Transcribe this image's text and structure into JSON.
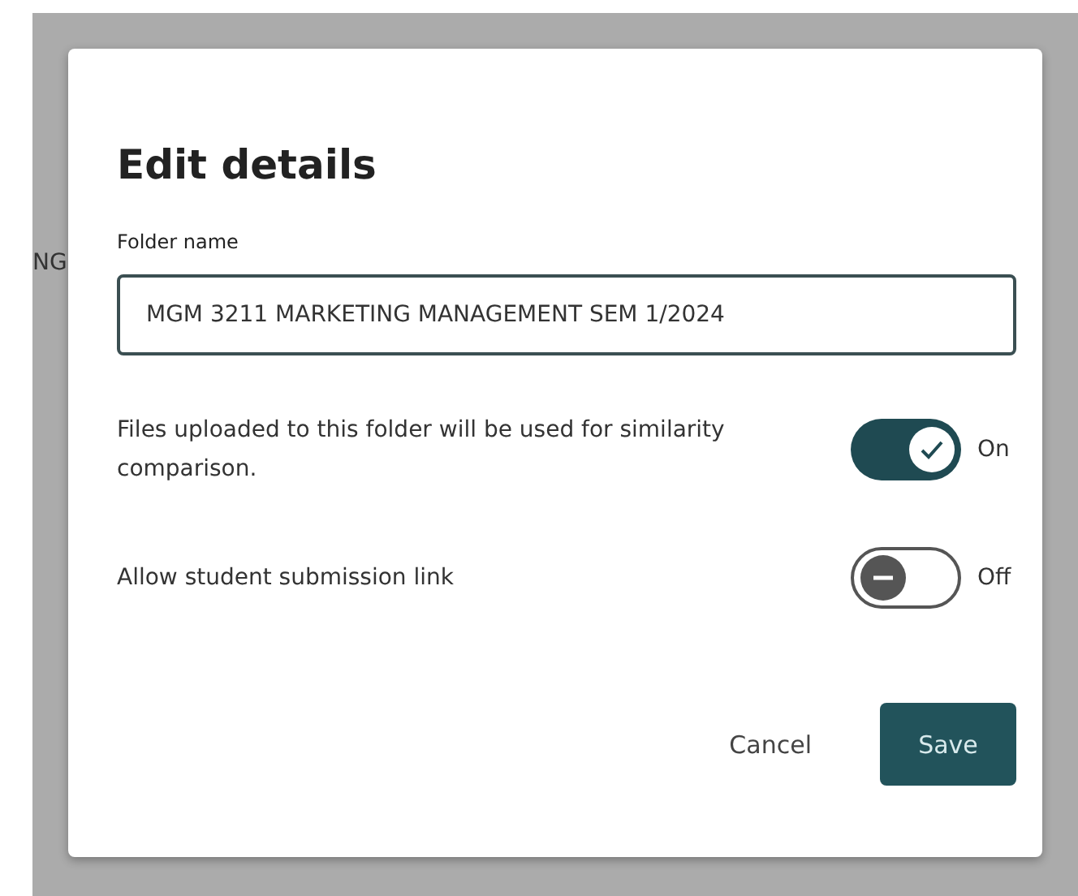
{
  "background": {
    "partial_text": "NG"
  },
  "dialog": {
    "title": "Edit details",
    "folder_name": {
      "label": "Folder name",
      "value": "MGM 3211 MARKETING MANAGEMENT SEM 1/2024"
    },
    "toggles": [
      {
        "label": "Files uploaded to this folder will be used for similarity comparison.",
        "on": true,
        "state_text": "On"
      },
      {
        "label": "Allow student submission link",
        "on": false,
        "state_text": "Off"
      }
    ],
    "buttons": [
      {
        "label": "Cancel",
        "kind": "secondary"
      },
      {
        "label": "Save",
        "kind": "primary"
      }
    ]
  }
}
